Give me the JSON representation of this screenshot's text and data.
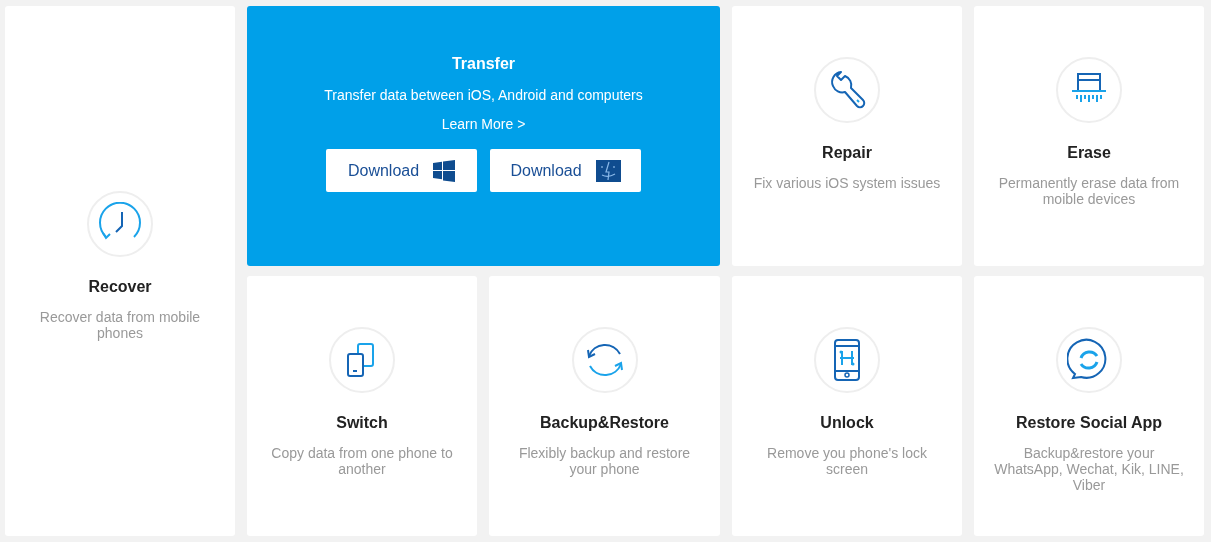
{
  "cards": [
    {
      "kind": "feature",
      "title": "Recover",
      "description": "Recover data from mobile phones"
    },
    {
      "kind": "promo",
      "title": "Transfer",
      "description": "Transfer data between iOS, Android and computers",
      "link": "Learn More >",
      "buttons": [
        {
          "label": "Download",
          "kind": "windows"
        },
        {
          "label": "Download",
          "kind": "mac"
        }
      ]
    },
    {
      "kind": "feature",
      "title": "Repair",
      "description": "Fix various iOS system issues"
    },
    {
      "kind": "feature",
      "title": "Erase",
      "description": "Permanently erase data from moible devices"
    },
    {
      "kind": "feature",
      "title": "Switch",
      "description": "Copy data from one phone to another"
    },
    {
      "kind": "feature",
      "title": "Backup&Restore",
      "description": "Flexibly backup and restore your phone"
    },
    {
      "kind": "feature",
      "title": "Unlock",
      "description": "Remove you phone's lock screen"
    },
    {
      "kind": "feature",
      "title": "Restore Social App",
      "description": "Backup&restore your WhatsApp, Wechat, Kik, LINE, Viber"
    }
  ]
}
